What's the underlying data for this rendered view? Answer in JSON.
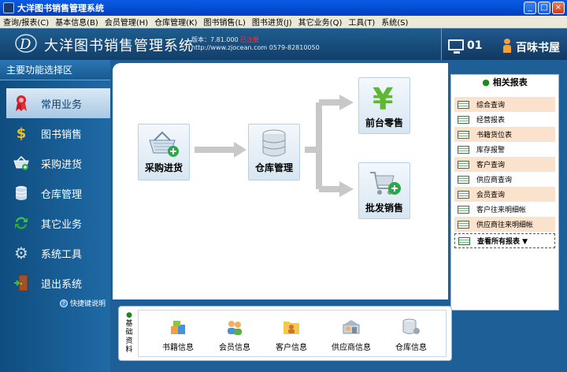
{
  "window": {
    "title": "大洋图书销售管理系统"
  },
  "menu": [
    "查询/报表(C)",
    "基本信息(B)",
    "会员管理(H)",
    "仓库管理(K)",
    "图书销售(L)",
    "图书进货(J)",
    "其它业务(Q)",
    "工具(T)",
    "系统(S)"
  ],
  "header": {
    "app_title": "大洋图书销售管理系统",
    "version_label": "版本：7.81.000",
    "version_status": "已注册",
    "website": "http://www.zjocean.com",
    "phone": "0579-82810050",
    "terminal": "01",
    "shop_name": "百味书屋"
  },
  "sidebar": {
    "title": "主要功能选择区",
    "items": [
      {
        "label": "常用业务",
        "icon": "ribbon-icon"
      },
      {
        "label": "图书销售",
        "icon": "dollar-icon"
      },
      {
        "label": "采购进货",
        "icon": "basket-add-icon"
      },
      {
        "label": "仓库管理",
        "icon": "database-icon"
      },
      {
        "label": "其它业务",
        "icon": "refresh-icon"
      },
      {
        "label": "系统工具",
        "icon": "gear-icon"
      },
      {
        "label": "退出系统",
        "icon": "exit-door-icon"
      }
    ],
    "help": "快捷键说明"
  },
  "flow": {
    "purchase": "采购进货",
    "warehouse": "仓库管理",
    "retail": "前台零售",
    "wholesale": "批发销售"
  },
  "reports": {
    "title": "相关报表",
    "items": [
      "综合查询",
      "经营报表",
      "书籍货位表",
      "库存报警",
      "客户查询",
      "供应商查询",
      "会员查询",
      "客户往来明细帐",
      "供应商往来明细帐"
    ],
    "more": "查看所有报表 ▼"
  },
  "basic": {
    "tag": "基础资料",
    "items": [
      {
        "label": "书籍信息",
        "icon": "books-icon"
      },
      {
        "label": "会员信息",
        "icon": "members-icon"
      },
      {
        "label": "客户信息",
        "icon": "customer-folder-icon"
      },
      {
        "label": "供应商信息",
        "icon": "supplier-icon"
      },
      {
        "label": "仓库信息",
        "icon": "warehouse-db-icon"
      }
    ]
  },
  "colors": {
    "accent": "#1f5f98",
    "menu_bg": "#ece9d8",
    "highlight": "#fbe2cc"
  }
}
